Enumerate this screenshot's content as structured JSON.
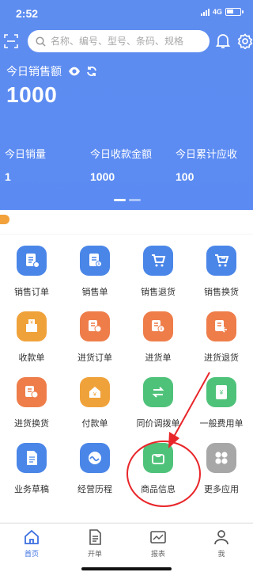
{
  "status_bar": {
    "time": "2:52",
    "network": "4G"
  },
  "search": {
    "placeholder": "名称、编号、型号、条码、规格"
  },
  "sales": {
    "title": "今日销售额",
    "value": "1000",
    "metrics": [
      {
        "label": "今日销量",
        "value": "1"
      },
      {
        "label": "今日收款金额",
        "value": "1000"
      },
      {
        "label": "今日累计应收",
        "value": "100"
      }
    ]
  },
  "menu": [
    {
      "label": "销售订单",
      "icon": "sales-order-icon",
      "color": "#4a86e8"
    },
    {
      "label": "销售单",
      "icon": "sales-invoice-icon",
      "color": "#4a86e8"
    },
    {
      "label": "销售退货",
      "icon": "sales-return-icon",
      "color": "#4a86e8"
    },
    {
      "label": "销售换货",
      "icon": "sales-exchange-icon",
      "color": "#4a86e8"
    },
    {
      "label": "收款单",
      "icon": "receipt-icon",
      "color": "#f0a23a"
    },
    {
      "label": "进货订单",
      "icon": "purchase-order-icon",
      "color": "#ee7d4a"
    },
    {
      "label": "进货单",
      "icon": "purchase-invoice-icon",
      "color": "#ee7d4a"
    },
    {
      "label": "进货退货",
      "icon": "purchase-return-icon",
      "color": "#ee7d4a"
    },
    {
      "label": "进货换货",
      "icon": "purchase-exchange-icon",
      "color": "#ee7d4a"
    },
    {
      "label": "付款单",
      "icon": "payment-icon",
      "color": "#f0a23a"
    },
    {
      "label": "同价调拨单",
      "icon": "transfer-icon",
      "color": "#4fc27a"
    },
    {
      "label": "一般费用单",
      "icon": "expense-icon",
      "color": "#4fc27a"
    },
    {
      "label": "业务草稿",
      "icon": "draft-icon",
      "color": "#4a86e8"
    },
    {
      "label": "经营历程",
      "icon": "history-icon",
      "color": "#4a86e8"
    },
    {
      "label": "商品信息",
      "icon": "product-bag-icon",
      "color": "#4fc27a"
    },
    {
      "label": "更多应用",
      "icon": "more-apps-icon",
      "color": "#a7a7a7"
    }
  ],
  "tabs": [
    {
      "label": "首页",
      "icon": "home-icon",
      "active": true
    },
    {
      "label": "开单",
      "icon": "document-icon",
      "active": false
    },
    {
      "label": "报表",
      "icon": "chart-icon",
      "active": false
    },
    {
      "label": "我",
      "icon": "user-icon",
      "active": false
    }
  ],
  "colors": {
    "primary": "#5b8bf2",
    "annotation": "#e8262a",
    "active_tab": "#3b6fe0"
  }
}
